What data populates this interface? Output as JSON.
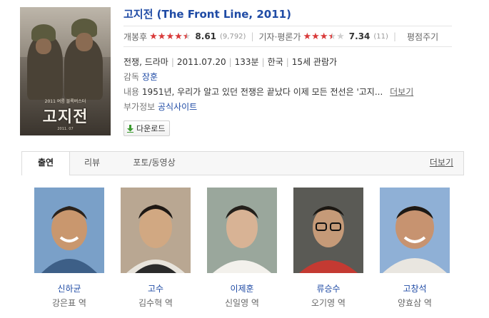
{
  "movie": {
    "title_ko": "고지전",
    "title_en": "(The Front Line, 2011)",
    "poster": {
      "title_text": "고지전",
      "sub_text": "2011 여름 블록버스터",
      "foot_text": "2011. 07"
    }
  },
  "ratings": {
    "audience": {
      "label": "개봉후",
      "score": "8.61",
      "count": "(9,792)",
      "stars": 4.5
    },
    "critic": {
      "label": "기자·평론가",
      "score": "7.34",
      "count": "(11)",
      "stars": 3.5
    },
    "cutoff_label": "평점주기"
  },
  "info": {
    "genre": "전쟁, 드라마",
    "release": "2011.07.20",
    "runtime": "133분",
    "country": "한국",
    "grade": "15세 관람가",
    "director_label": "감독",
    "director": "장훈",
    "synopsis_label": "내용",
    "synopsis": "1951년, 우리가 알고 있던 전쟁은 끝났다 이제 모든 전선은 '고지...",
    "synopsis_more": "더보기",
    "extra_label": "부가정보",
    "extra_link": "공식사이트"
  },
  "download": {
    "label": "다운로드"
  },
  "tabs": {
    "items": [
      {
        "label": "출연"
      },
      {
        "label": "리뷰"
      },
      {
        "label": "포토/동영상"
      }
    ],
    "more": "더보기"
  },
  "cast": [
    {
      "name": "신하균",
      "role": "강은표 역"
    },
    {
      "name": "고수",
      "role": "김수혁 역"
    },
    {
      "name": "이제훈",
      "role": "신일영 역"
    },
    {
      "name": "류승수",
      "role": "오기영 역"
    },
    {
      "name": "고창석",
      "role": "양효삼 역"
    }
  ],
  "colors": {
    "link": "#1f4ba5",
    "star": "#d93a3a",
    "download_arrow": "#3a9a2e"
  },
  "icons": {
    "download": "download-arrow-icon",
    "star": "star-icon"
  }
}
